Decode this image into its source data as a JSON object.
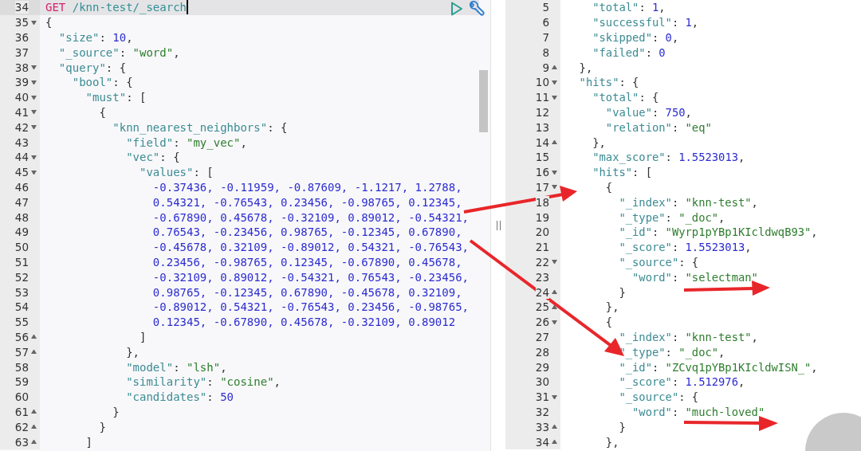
{
  "request_editor": {
    "lines": [
      {
        "line_number": "34",
        "kind": "plain",
        "active": true,
        "tokens": [
          {
            "kind": "method",
            "text": "GET"
          },
          {
            "kind": "path",
            "text": " /knn-test/_search"
          }
        ]
      },
      {
        "line_number": "35",
        "kind": "fold_start",
        "active": false,
        "tokens": [
          {
            "kind": "punct",
            "text": "{"
          }
        ]
      },
      {
        "line_number": "36",
        "kind": "plain",
        "active": false,
        "tokens": [
          {
            "kind": "key",
            "text": "  \"size\""
          },
          {
            "kind": "punct",
            "text": ": "
          },
          {
            "kind": "number",
            "text": "10"
          },
          {
            "kind": "punct",
            "text": ","
          }
        ]
      },
      {
        "line_number": "37",
        "kind": "plain",
        "active": false,
        "tokens": [
          {
            "kind": "key",
            "text": "  \"_source\""
          },
          {
            "kind": "punct",
            "text": ": "
          },
          {
            "kind": "string",
            "text": "\"word\""
          },
          {
            "kind": "punct",
            "text": ","
          }
        ]
      },
      {
        "line_number": "38",
        "kind": "fold_start",
        "active": false,
        "tokens": [
          {
            "kind": "key",
            "text": "  \"query\""
          },
          {
            "kind": "punct",
            "text": ": {"
          }
        ]
      },
      {
        "line_number": "39",
        "kind": "fold_start",
        "active": false,
        "tokens": [
          {
            "kind": "key",
            "text": "    \"bool\""
          },
          {
            "kind": "punct",
            "text": ": {"
          }
        ]
      },
      {
        "line_number": "40",
        "kind": "fold_start",
        "active": false,
        "tokens": [
          {
            "kind": "key",
            "text": "      \"must\""
          },
          {
            "kind": "punct",
            "text": ": ["
          }
        ]
      },
      {
        "line_number": "41",
        "kind": "fold_start",
        "active": false,
        "tokens": [
          {
            "kind": "punct",
            "text": "        {"
          }
        ]
      },
      {
        "line_number": "42",
        "kind": "fold_start",
        "active": false,
        "tokens": [
          {
            "kind": "key",
            "text": "          \"knn_nearest_neighbors\""
          },
          {
            "kind": "punct",
            "text": ": {"
          }
        ]
      },
      {
        "line_number": "43",
        "kind": "plain",
        "active": false,
        "tokens": [
          {
            "kind": "key",
            "text": "            \"field\""
          },
          {
            "kind": "punct",
            "text": ": "
          },
          {
            "kind": "string",
            "text": "\"my_vec\""
          },
          {
            "kind": "punct",
            "text": ","
          }
        ]
      },
      {
        "line_number": "44",
        "kind": "fold_start",
        "active": false,
        "tokens": [
          {
            "kind": "key",
            "text": "            \"vec\""
          },
          {
            "kind": "punct",
            "text": ": {"
          }
        ]
      },
      {
        "line_number": "45",
        "kind": "fold_start",
        "active": false,
        "tokens": [
          {
            "kind": "key",
            "text": "              \"values\""
          },
          {
            "kind": "punct",
            "text": ": ["
          }
        ]
      },
      {
        "line_number": "46",
        "kind": "plain",
        "active": false,
        "tokens": [
          {
            "kind": "number",
            "text": "                -0.37436, -0.11959, -0.87609, -1.1217, 1.2788,"
          }
        ]
      },
      {
        "line_number": "47",
        "kind": "plain",
        "active": false,
        "tokens": [
          {
            "kind": "number",
            "text": "                0.54321, -0.76543, 0.23456, -0.98765, 0.12345,"
          }
        ]
      },
      {
        "line_number": "48",
        "kind": "plain",
        "active": false,
        "tokens": [
          {
            "kind": "number",
            "text": "                -0.67890, 0.45678, -0.32109, 0.89012, -0.54321,"
          }
        ]
      },
      {
        "line_number": "49",
        "kind": "plain",
        "active": false,
        "tokens": [
          {
            "kind": "number",
            "text": "                0.76543, -0.23456, 0.98765, -0.12345, 0.67890,"
          }
        ]
      },
      {
        "line_number": "50",
        "kind": "plain",
        "active": false,
        "tokens": [
          {
            "kind": "number",
            "text": "                -0.45678, 0.32109, -0.89012, 0.54321, -0.76543,"
          }
        ]
      },
      {
        "line_number": "51",
        "kind": "plain",
        "active": false,
        "tokens": [
          {
            "kind": "number",
            "text": "                0.23456, -0.98765, 0.12345, -0.67890, 0.45678,"
          }
        ]
      },
      {
        "line_number": "52",
        "kind": "plain",
        "active": false,
        "tokens": [
          {
            "kind": "number",
            "text": "                -0.32109, 0.89012, -0.54321, 0.76543, -0.23456,"
          }
        ]
      },
      {
        "line_number": "53",
        "kind": "plain",
        "active": false,
        "tokens": [
          {
            "kind": "number",
            "text": "                0.98765, -0.12345, 0.67890, -0.45678, 0.32109,"
          }
        ]
      },
      {
        "line_number": "54",
        "kind": "plain",
        "active": false,
        "tokens": [
          {
            "kind": "number",
            "text": "                -0.89012, 0.54321, -0.76543, 0.23456, -0.98765,"
          }
        ]
      },
      {
        "line_number": "55",
        "kind": "plain",
        "active": false,
        "tokens": [
          {
            "kind": "number",
            "text": "                0.12345, -0.67890, 0.45678, -0.32109, 0.89012"
          }
        ]
      },
      {
        "line_number": "56",
        "kind": "fold_end",
        "active": false,
        "tokens": [
          {
            "kind": "punct",
            "text": "              ]"
          }
        ]
      },
      {
        "line_number": "57",
        "kind": "fold_end",
        "active": false,
        "tokens": [
          {
            "kind": "punct",
            "text": "            },"
          }
        ]
      },
      {
        "line_number": "58",
        "kind": "plain",
        "active": false,
        "tokens": [
          {
            "kind": "key",
            "text": "            \"model\""
          },
          {
            "kind": "punct",
            "text": ": "
          },
          {
            "kind": "string",
            "text": "\"lsh\""
          },
          {
            "kind": "punct",
            "text": ","
          }
        ]
      },
      {
        "line_number": "59",
        "kind": "plain",
        "active": false,
        "tokens": [
          {
            "kind": "key",
            "text": "            \"similarity\""
          },
          {
            "kind": "punct",
            "text": ": "
          },
          {
            "kind": "string",
            "text": "\"cosine\""
          },
          {
            "kind": "punct",
            "text": ","
          }
        ]
      },
      {
        "line_number": "60",
        "kind": "plain",
        "active": false,
        "tokens": [
          {
            "kind": "key",
            "text": "            \"candidates\""
          },
          {
            "kind": "punct",
            "text": ": "
          },
          {
            "kind": "number",
            "text": "50"
          }
        ]
      },
      {
        "line_number": "61",
        "kind": "fold_end",
        "active": false,
        "tokens": [
          {
            "kind": "punct",
            "text": "          }"
          }
        ]
      },
      {
        "line_number": "62",
        "kind": "fold_end",
        "active": false,
        "tokens": [
          {
            "kind": "punct",
            "text": "        }"
          }
        ]
      },
      {
        "line_number": "63",
        "kind": "fold_end",
        "active": false,
        "tokens": [
          {
            "kind": "punct",
            "text": "      ]"
          }
        ]
      }
    ]
  },
  "response_viewer": {
    "lines": [
      {
        "line_number": "5",
        "kind": "plain",
        "tokens": [
          {
            "kind": "key",
            "text": "    \"total\""
          },
          {
            "kind": "punct",
            "text": ": "
          },
          {
            "kind": "number",
            "text": "1"
          },
          {
            "kind": "punct",
            "text": ","
          }
        ]
      },
      {
        "line_number": "6",
        "kind": "plain",
        "tokens": [
          {
            "kind": "key",
            "text": "    \"successful\""
          },
          {
            "kind": "punct",
            "text": ": "
          },
          {
            "kind": "number",
            "text": "1"
          },
          {
            "kind": "punct",
            "text": ","
          }
        ]
      },
      {
        "line_number": "7",
        "kind": "plain",
        "tokens": [
          {
            "kind": "key",
            "text": "    \"skipped\""
          },
          {
            "kind": "punct",
            "text": ": "
          },
          {
            "kind": "number",
            "text": "0"
          },
          {
            "kind": "punct",
            "text": ","
          }
        ]
      },
      {
        "line_number": "8",
        "kind": "plain",
        "tokens": [
          {
            "kind": "key",
            "text": "    \"failed\""
          },
          {
            "kind": "punct",
            "text": ": "
          },
          {
            "kind": "number",
            "text": "0"
          }
        ]
      },
      {
        "line_number": "9",
        "kind": "fold_end",
        "tokens": [
          {
            "kind": "punct",
            "text": "  },"
          }
        ]
      },
      {
        "line_number": "10",
        "kind": "fold_start",
        "tokens": [
          {
            "kind": "key",
            "text": "  \"hits\""
          },
          {
            "kind": "punct",
            "text": ": {"
          }
        ]
      },
      {
        "line_number": "11",
        "kind": "fold_start",
        "tokens": [
          {
            "kind": "key",
            "text": "    \"total\""
          },
          {
            "kind": "punct",
            "text": ": {"
          }
        ]
      },
      {
        "line_number": "12",
        "kind": "plain",
        "tokens": [
          {
            "kind": "key",
            "text": "      \"value\""
          },
          {
            "kind": "punct",
            "text": ": "
          },
          {
            "kind": "number",
            "text": "750"
          },
          {
            "kind": "punct",
            "text": ","
          }
        ]
      },
      {
        "line_number": "13",
        "kind": "plain",
        "tokens": [
          {
            "kind": "key",
            "text": "      \"relation\""
          },
          {
            "kind": "punct",
            "text": ": "
          },
          {
            "kind": "string",
            "text": "\"eq\""
          }
        ]
      },
      {
        "line_number": "14",
        "kind": "fold_end",
        "tokens": [
          {
            "kind": "punct",
            "text": "    },"
          }
        ]
      },
      {
        "line_number": "15",
        "kind": "plain",
        "tokens": [
          {
            "kind": "key",
            "text": "    \"max_score\""
          },
          {
            "kind": "punct",
            "text": ": "
          },
          {
            "kind": "number",
            "text": "1.5523013"
          },
          {
            "kind": "punct",
            "text": ","
          }
        ]
      },
      {
        "line_number": "16",
        "kind": "fold_start",
        "tokens": [
          {
            "kind": "key",
            "text": "    \"hits\""
          },
          {
            "kind": "punct",
            "text": ": ["
          }
        ]
      },
      {
        "line_number": "17",
        "kind": "fold_start",
        "tokens": [
          {
            "kind": "punct",
            "text": "      {"
          }
        ]
      },
      {
        "line_number": "18",
        "kind": "plain",
        "tokens": [
          {
            "kind": "key",
            "text": "        \"_index\""
          },
          {
            "kind": "punct",
            "text": ": "
          },
          {
            "kind": "string",
            "text": "\"knn-test\""
          },
          {
            "kind": "punct",
            "text": ","
          }
        ]
      },
      {
        "line_number": "19",
        "kind": "plain",
        "tokens": [
          {
            "kind": "key",
            "text": "        \"_type\""
          },
          {
            "kind": "punct",
            "text": ": "
          },
          {
            "kind": "string",
            "text": "\"_doc\""
          },
          {
            "kind": "punct",
            "text": ","
          }
        ]
      },
      {
        "line_number": "20",
        "kind": "plain",
        "tokens": [
          {
            "kind": "key",
            "text": "        \"_id\""
          },
          {
            "kind": "punct",
            "text": ": "
          },
          {
            "kind": "string",
            "text": "\"Wyrp1pYBp1KIcldwqB93\""
          },
          {
            "kind": "punct",
            "text": ","
          }
        ]
      },
      {
        "line_number": "21",
        "kind": "plain",
        "tokens": [
          {
            "kind": "key",
            "text": "        \"_score\""
          },
          {
            "kind": "punct",
            "text": ": "
          },
          {
            "kind": "number",
            "text": "1.5523013"
          },
          {
            "kind": "punct",
            "text": ","
          }
        ]
      },
      {
        "line_number": "22",
        "kind": "fold_start",
        "tokens": [
          {
            "kind": "key",
            "text": "        \"_source\""
          },
          {
            "kind": "punct",
            "text": ": {"
          }
        ]
      },
      {
        "line_number": "23",
        "kind": "plain",
        "tokens": [
          {
            "kind": "key",
            "text": "          \"word\""
          },
          {
            "kind": "punct",
            "text": ": "
          },
          {
            "kind": "string",
            "text": "\"selectman\""
          }
        ]
      },
      {
        "line_number": "24",
        "kind": "fold_end",
        "tokens": [
          {
            "kind": "punct",
            "text": "        }"
          }
        ]
      },
      {
        "line_number": "25",
        "kind": "fold_end",
        "tokens": [
          {
            "kind": "punct",
            "text": "      },"
          }
        ]
      },
      {
        "line_number": "26",
        "kind": "fold_start",
        "tokens": [
          {
            "kind": "punct",
            "text": "      {"
          }
        ]
      },
      {
        "line_number": "27",
        "kind": "plain",
        "tokens": [
          {
            "kind": "key",
            "text": "        \"_index\""
          },
          {
            "kind": "punct",
            "text": ": "
          },
          {
            "kind": "string",
            "text": "\"knn-test\""
          },
          {
            "kind": "punct",
            "text": ","
          }
        ]
      },
      {
        "line_number": "28",
        "kind": "plain",
        "tokens": [
          {
            "kind": "key",
            "text": "        \"_type\""
          },
          {
            "kind": "punct",
            "text": ": "
          },
          {
            "kind": "string",
            "text": "\"_doc\""
          },
          {
            "kind": "punct",
            "text": ","
          }
        ]
      },
      {
        "line_number": "29",
        "kind": "plain",
        "tokens": [
          {
            "kind": "key",
            "text": "        \"_id\""
          },
          {
            "kind": "punct",
            "text": ": "
          },
          {
            "kind": "string",
            "text": "\"ZCvq1pYBp1KIcldwISN_\""
          },
          {
            "kind": "punct",
            "text": ","
          }
        ]
      },
      {
        "line_number": "30",
        "kind": "plain",
        "tokens": [
          {
            "kind": "key",
            "text": "        \"_score\""
          },
          {
            "kind": "punct",
            "text": ": "
          },
          {
            "kind": "number",
            "text": "1.512976"
          },
          {
            "kind": "punct",
            "text": ","
          }
        ]
      },
      {
        "line_number": "31",
        "kind": "fold_start",
        "tokens": [
          {
            "kind": "key",
            "text": "        \"_source\""
          },
          {
            "kind": "punct",
            "text": ": {"
          }
        ]
      },
      {
        "line_number": "32",
        "kind": "plain",
        "tokens": [
          {
            "kind": "key",
            "text": "          \"word\""
          },
          {
            "kind": "punct",
            "text": ": "
          },
          {
            "kind": "string",
            "text": "\"much-loved\""
          }
        ]
      },
      {
        "line_number": "33",
        "kind": "fold_end",
        "tokens": [
          {
            "kind": "punct",
            "text": "        }"
          }
        ]
      },
      {
        "line_number": "34",
        "kind": "fold_end",
        "tokens": [
          {
            "kind": "punct",
            "text": "      },"
          }
        ]
      }
    ]
  }
}
